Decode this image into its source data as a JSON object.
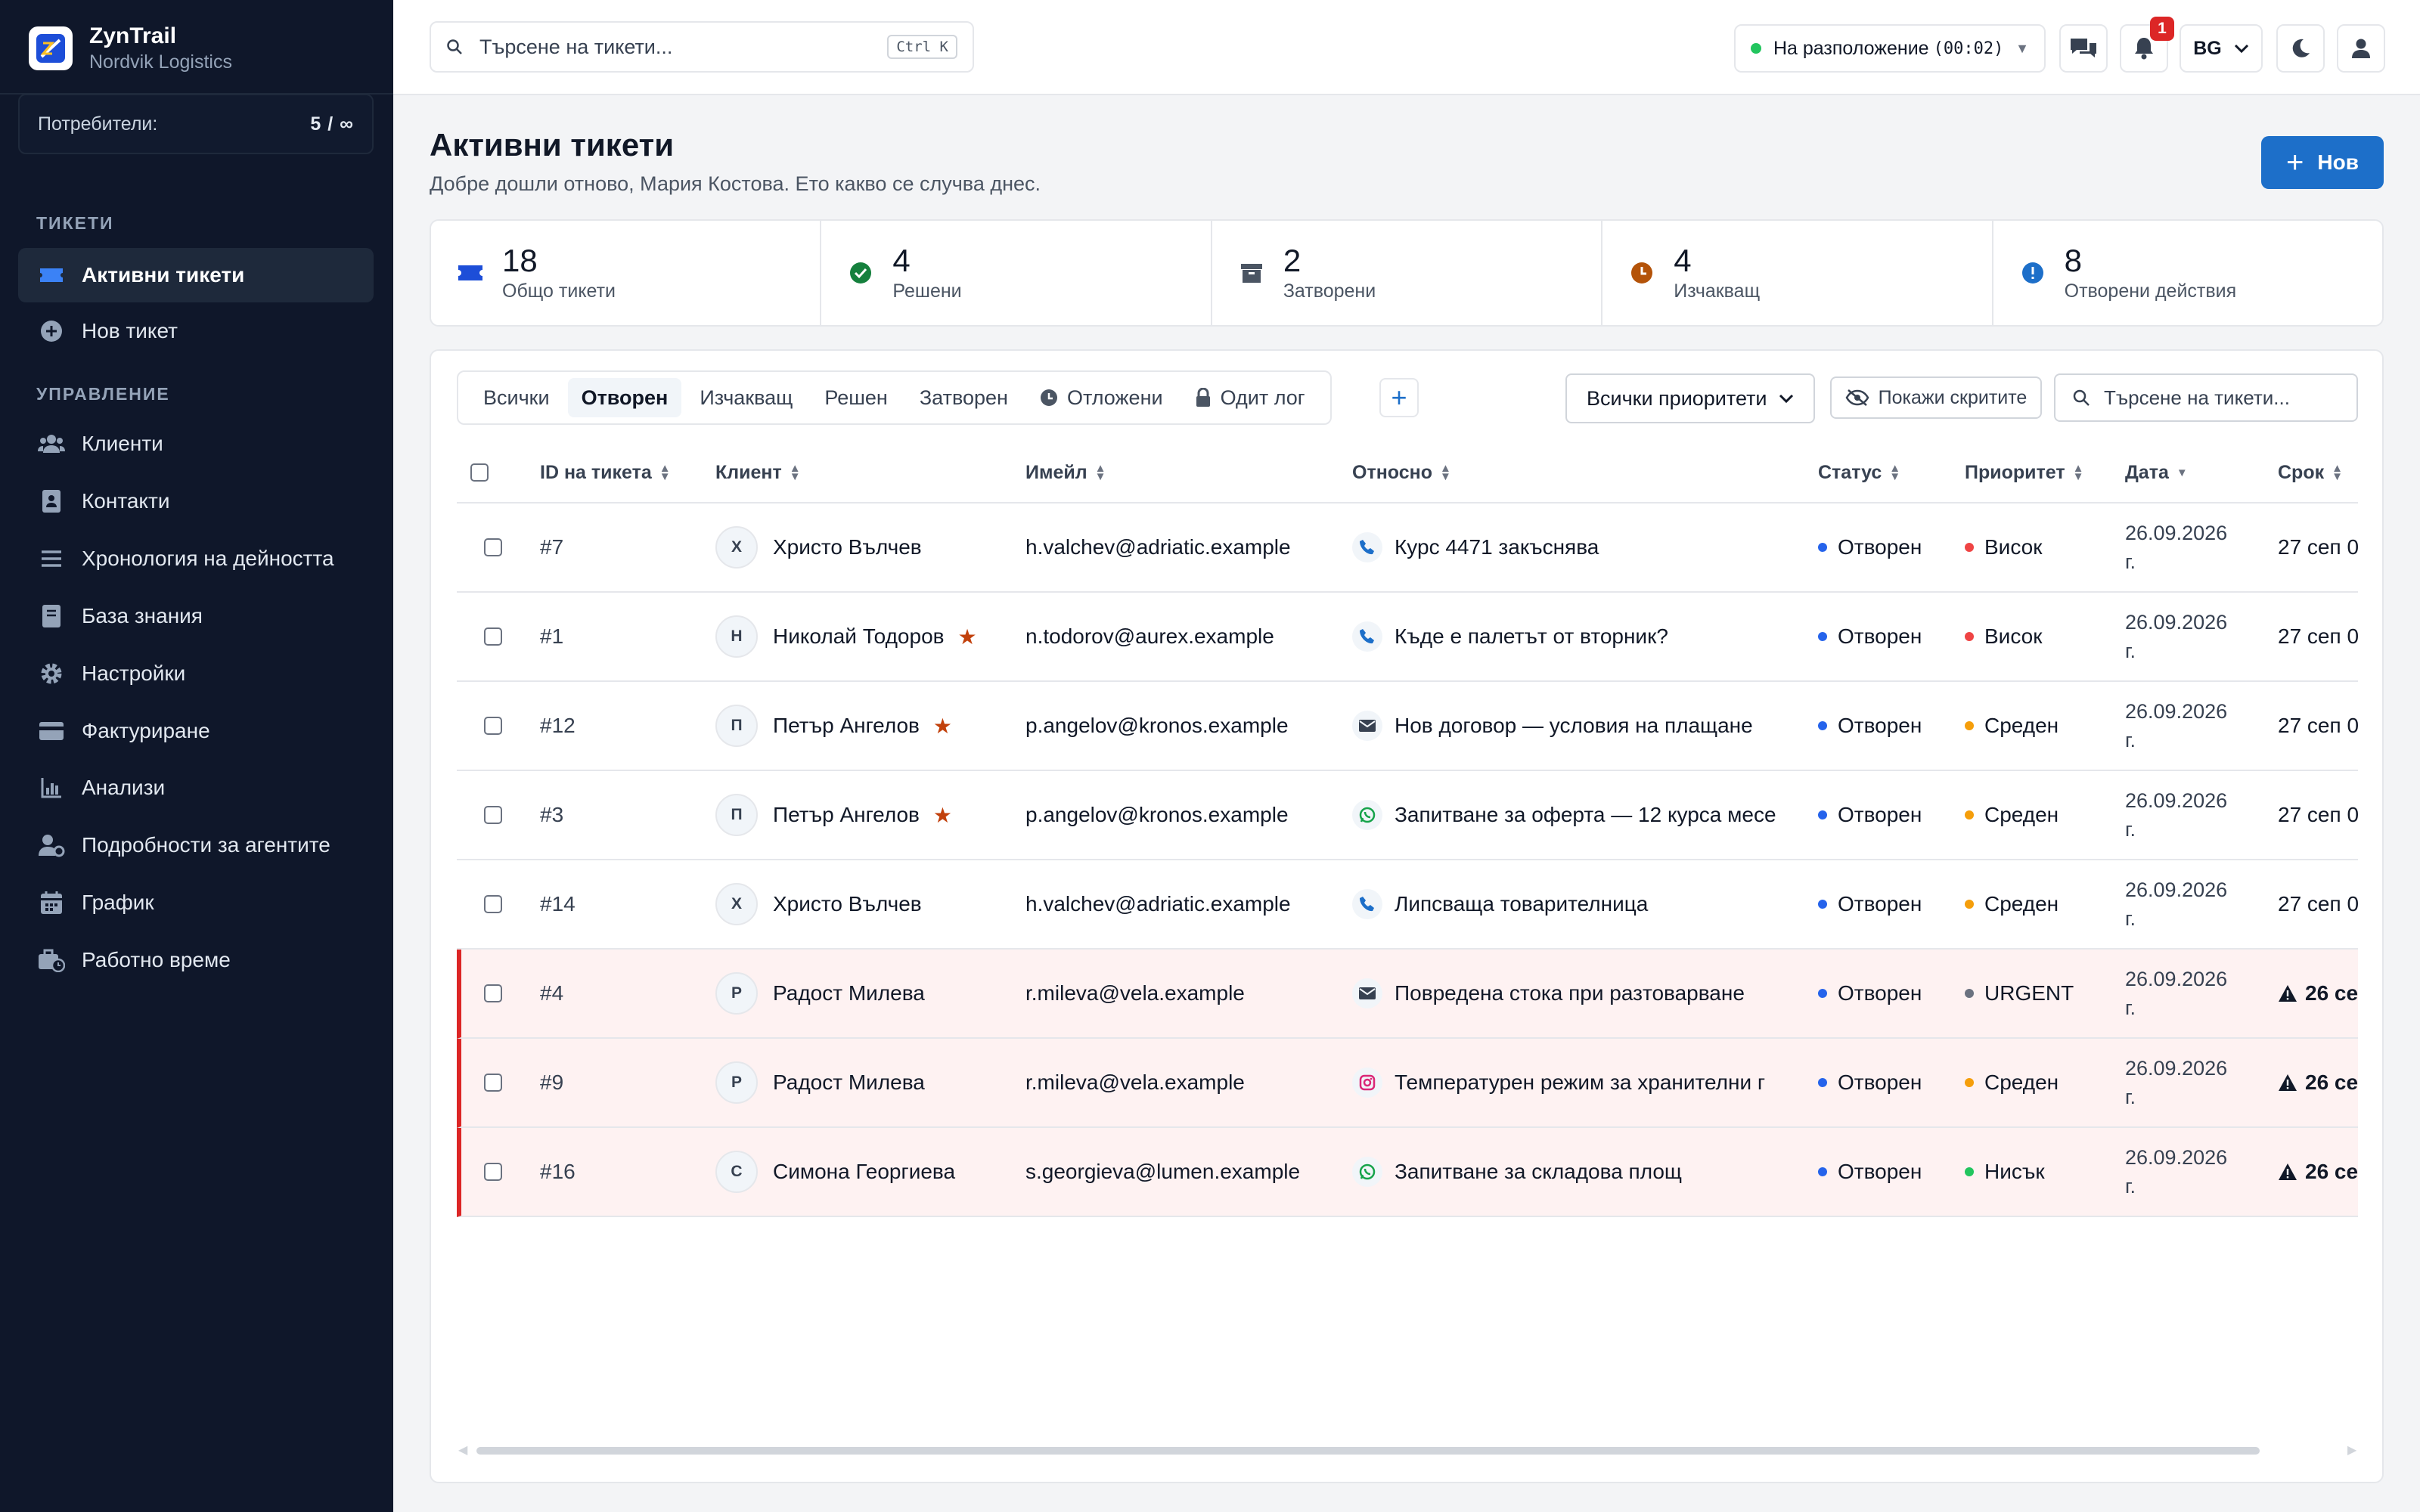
{
  "app": {
    "name": "ZynTrail",
    "org": "Nordvik Logistics"
  },
  "users": {
    "label": "Потребители:",
    "count": "5 / ∞"
  },
  "sidebar": {
    "section_tickets": "ТИКЕТИ",
    "section_manage": "УПРАВЛЕНИЕ",
    "items": [
      {
        "label": "Активни тикети",
        "icon": "ticket-icon",
        "active": true
      },
      {
        "label": "Нов тикет",
        "icon": "plus-circle-icon"
      },
      {
        "label": "Клиенти",
        "icon": "users-icon"
      },
      {
        "label": "Контакти",
        "icon": "address-book-icon"
      },
      {
        "label": "Хронология на дейността",
        "icon": "list-icon"
      },
      {
        "label": "База знания",
        "icon": "book-icon"
      },
      {
        "label": "Настройки",
        "icon": "gear-icon"
      },
      {
        "label": "Фактуриране",
        "icon": "credit-card-icon"
      },
      {
        "label": "Анализи",
        "icon": "chart-icon"
      },
      {
        "label": "Подробности за агентите",
        "icon": "user-gear-icon"
      },
      {
        "label": "График",
        "icon": "calendar-icon"
      },
      {
        "label": "Работно време",
        "icon": "business-time-icon"
      }
    ]
  },
  "topbar": {
    "search_placeholder": "Търсене на тикети...",
    "shortcut": "Ctrl K",
    "availability": "На разположение",
    "availability_time": "(00:02)",
    "notifications": "1",
    "language": "BG"
  },
  "page": {
    "title": "Активни тикети",
    "subtitle": "Добре дошли отново, Мария Костова. Ето какво се случва днес.",
    "new_button": "Нов"
  },
  "stats": [
    {
      "value": "18",
      "label": "Общо тикети",
      "icon": "ticket-icon",
      "color": "#1d4ed8"
    },
    {
      "value": "4",
      "label": "Решени",
      "icon": "check-circle-icon",
      "color": "#15803d"
    },
    {
      "value": "2",
      "label": "Затворени",
      "icon": "archive-icon",
      "color": "#4b5563"
    },
    {
      "value": "4",
      "label": "Изчакващ",
      "icon": "clock-icon",
      "color": "#b45309"
    },
    {
      "value": "8",
      "label": "Отворени действия",
      "icon": "alert-circle-icon",
      "color": "#1d6fc9"
    }
  ],
  "tabs": [
    "Всички",
    "Отворен",
    "Изчакващ",
    "Решен",
    "Затворен",
    "Отложени",
    "Одит лог"
  ],
  "filters": {
    "priority": "Всички приоритети",
    "show_hidden": "Покажи скритите",
    "search_placeholder": "Търсене на тикети..."
  },
  "columns": [
    "ID на тикета",
    "Клиент",
    "Имейл",
    "Относно",
    "Статус",
    "Приоритет",
    "Дата",
    "Срок"
  ],
  "colors": {
    "open": "#2563eb",
    "high": "#ef4444",
    "medium": "#f59e0b",
    "urgent": "#6b7280",
    "low": "#22c55e",
    "accent": "#1d6fc9"
  },
  "tickets": [
    {
      "id": "#7",
      "initial": "Х",
      "client": "Христо Вълчев",
      "star": false,
      "email": "h.valchev@adriatic.example",
      "channel": "phone-icon",
      "subject": "Курс 4471 закъснява",
      "status": "Отворен",
      "priority": "Висок",
      "prio_color": "#ef4444",
      "date_line1": "26.09.2026",
      "date_line2": "г.",
      "due": "27 сеп 0",
      "urgent": false
    },
    {
      "id": "#1",
      "initial": "Н",
      "client": "Николай Тодоров",
      "star": true,
      "email": "n.todorov@aurex.example",
      "channel": "phone-icon",
      "subject": "Къде е палетът от вторник?",
      "status": "Отворен",
      "priority": "Висок",
      "prio_color": "#ef4444",
      "date_line1": "26.09.2026",
      "date_line2": "г.",
      "due": "27 сеп 0",
      "urgent": false
    },
    {
      "id": "#12",
      "initial": "П",
      "client": "Петър Ангелов",
      "star": true,
      "email": "p.angelov@kronos.example",
      "channel": "mail-icon",
      "subject": "Нов договор — условия на плащане",
      "status": "Отворен",
      "priority": "Среден",
      "prio_color": "#f59e0b",
      "date_line1": "26.09.2026",
      "date_line2": "г.",
      "due": "27 сеп 0",
      "urgent": false
    },
    {
      "id": "#3",
      "initial": "П",
      "client": "Петър Ангелов",
      "star": true,
      "email": "p.angelov@kronos.example",
      "channel": "whatsapp-icon",
      "subject": "Запитване за оферта — 12 курса месе",
      "status": "Отворен",
      "priority": "Среден",
      "prio_color": "#f59e0b",
      "date_line1": "26.09.2026",
      "date_line2": "г.",
      "due": "27 сеп 0",
      "urgent": false
    },
    {
      "id": "#14",
      "initial": "Х",
      "client": "Христо Вълчев",
      "star": false,
      "email": "h.valchev@adriatic.example",
      "channel": "phone-icon",
      "subject": "Липсваща товарителница",
      "status": "Отворен",
      "priority": "Среден",
      "prio_color": "#f59e0b",
      "date_line1": "26.09.2026",
      "date_line2": "г.",
      "due": "27 сеп 0",
      "urgent": false
    },
    {
      "id": "#4",
      "initial": "Р",
      "client": "Радост Милева",
      "star": false,
      "email": "r.mileva@vela.example",
      "channel": "mail-icon",
      "subject": "Повредена стока при разтоварване",
      "status": "Отворен",
      "priority": "URGENT",
      "prio_color": "#6b7280",
      "date_line1": "26.09.2026",
      "date_line2": "г.",
      "due": "26 се",
      "urgent": true
    },
    {
      "id": "#9",
      "initial": "Р",
      "client": "Радост Милева",
      "star": false,
      "email": "r.mileva@vela.example",
      "channel": "instagram-icon",
      "subject": "Температурен режим за хранителни г",
      "status": "Отворен",
      "priority": "Среден",
      "prio_color": "#f59e0b",
      "date_line1": "26.09.2026",
      "date_line2": "г.",
      "due": "26 се",
      "urgent": true
    },
    {
      "id": "#16",
      "initial": "С",
      "client": "Симона Георгиева",
      "star": false,
      "email": "s.georgieva@lumen.example",
      "channel": "whatsapp-icon",
      "subject": "Запитване за складова площ",
      "status": "Отворен",
      "priority": "Нисък",
      "prio_color": "#22c55e",
      "date_line1": "26.09.2026",
      "date_line2": "г.",
      "due": "26 се",
      "urgent": true
    }
  ]
}
